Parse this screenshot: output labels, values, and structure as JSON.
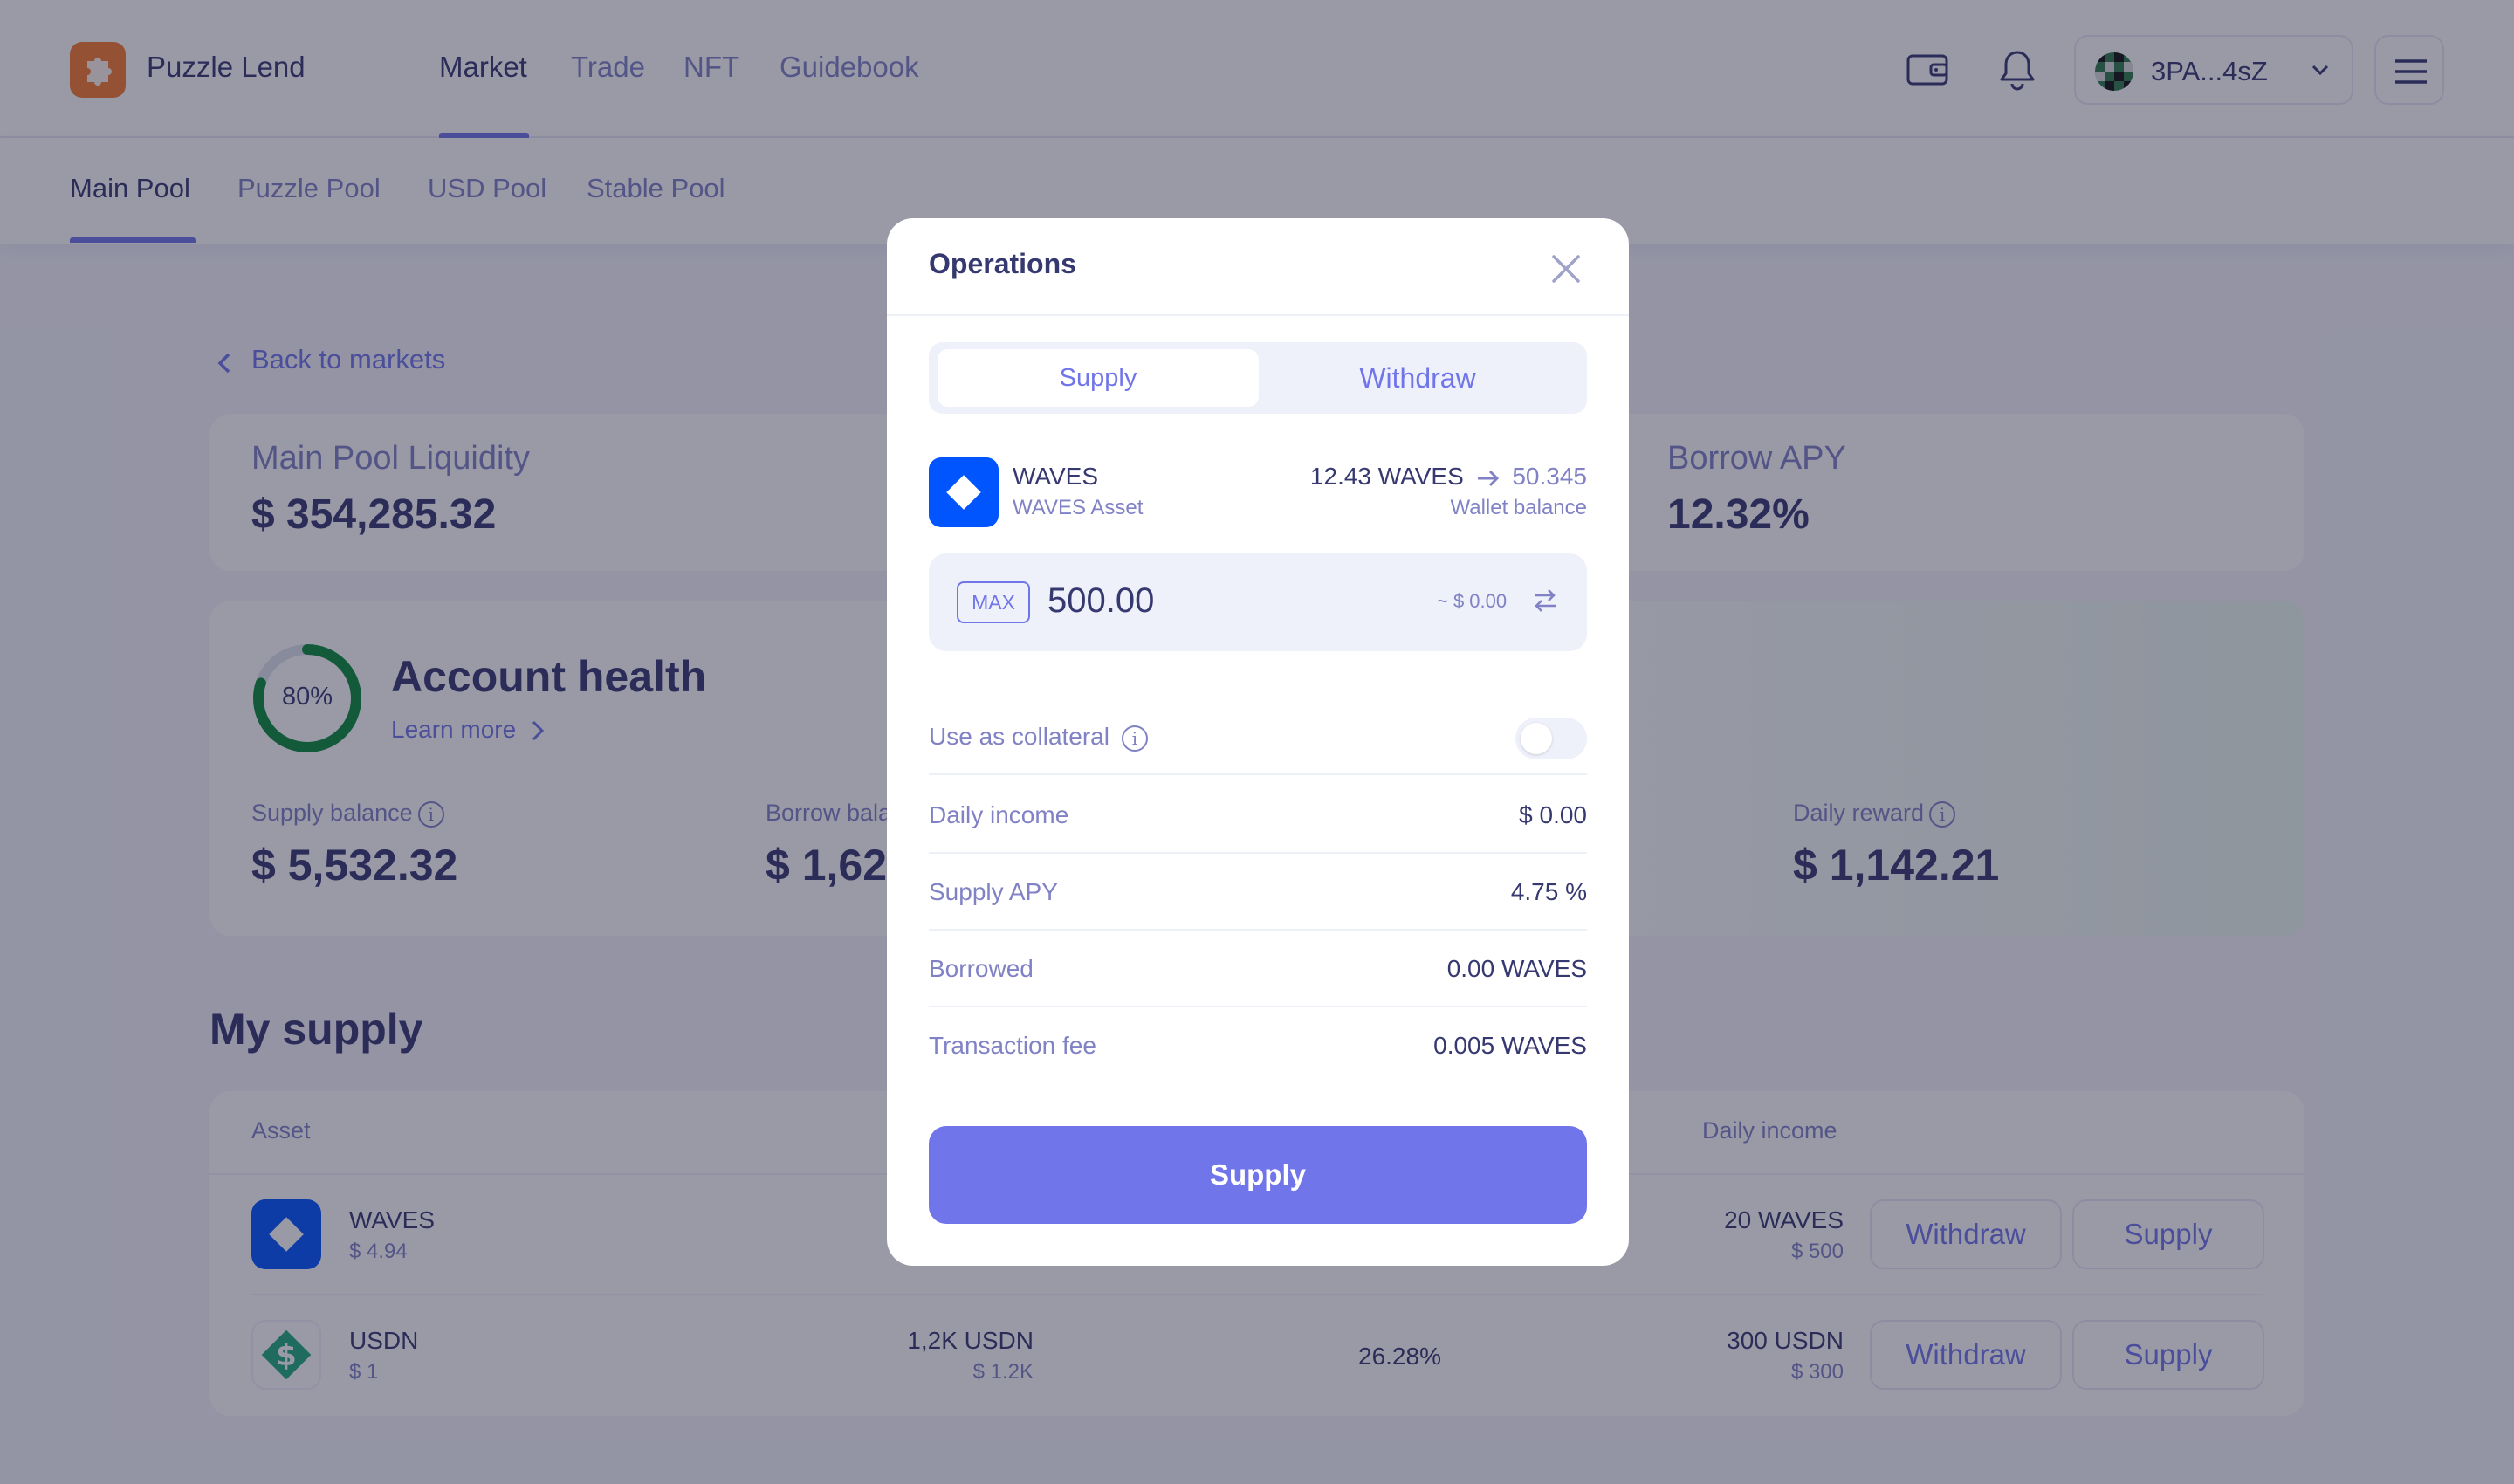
{
  "header": {
    "brand": "Puzzle Lend",
    "nav": [
      "Market",
      "Trade",
      "NFT",
      "Guidebook"
    ],
    "account": "3PA...4sZ"
  },
  "pool_tabs": [
    "Main Pool",
    "Puzzle Pool",
    "USD Pool",
    "Stable Pool"
  ],
  "back_label": "Back to markets",
  "stats": {
    "liquidity_label": "Main Pool Liquidity",
    "liquidity_value": "$ 354,285.32",
    "borrow_apy_label": "Borrow APY",
    "borrow_apy_value": "12.32%"
  },
  "health": {
    "percent_label": "80%",
    "percent": 0.8,
    "title": "Account health",
    "learn_more": "Learn more",
    "supply_balance_label": "Supply balance",
    "supply_balance_value": "$ 5,532.32",
    "borrow_balance_label": "Borrow bala",
    "borrow_balance_value": "$ 1,62",
    "daily_reward_label": "Daily reward",
    "daily_reward_value": "$ 1,142.21"
  },
  "my_supply": {
    "title": "My supply",
    "columns": {
      "asset": "Asset",
      "daily_income": "Daily income"
    },
    "rows": [
      {
        "name": "WAVES",
        "price": "$ 4.94",
        "supplied": "",
        "supplied_usd": "",
        "apy": "",
        "daily_income": "20 WAVES",
        "daily_income_usd": "$ 500",
        "withdraw": "Withdraw",
        "supply": "Supply"
      },
      {
        "name": "USDN",
        "price": "$ 1",
        "supplied": "1,2K USDN",
        "supplied_usd": "$ 1.2K",
        "apy": "26.28%",
        "daily_income": "300 USDN",
        "daily_income_usd": "$ 300",
        "withdraw": "Withdraw",
        "supply": "Supply"
      }
    ]
  },
  "modal": {
    "title": "Operations",
    "tabs": [
      "Supply",
      "Withdraw"
    ],
    "asset_name": "WAVES",
    "asset_sub": "WAVES Asset",
    "balance_from": "12.43 WAVES",
    "balance_to": "50.345",
    "balance_label": "Wallet balance",
    "max_label": "MAX",
    "amount": "500.00",
    "amount_usd": "~ $ 0.00",
    "collateral_label": "Use as collateral",
    "collateral_on": false,
    "rows": [
      {
        "label": "Daily income",
        "value": "$ 0.00"
      },
      {
        "label": "Supply APY",
        "value": "4.75 %"
      },
      {
        "label": "Borrowed",
        "value": "0.00 WAVES"
      },
      {
        "label": "Transaction fee",
        "value": "0.005 WAVES"
      }
    ],
    "submit": "Supply"
  },
  "colors": {
    "accent": "#7075e9",
    "text": "#363870",
    "muted": "#8082c5",
    "logo": "#f57a2d",
    "waves": "#0055ff",
    "usdn": "#1fa97c",
    "health_ring": "#0a8a3a"
  }
}
